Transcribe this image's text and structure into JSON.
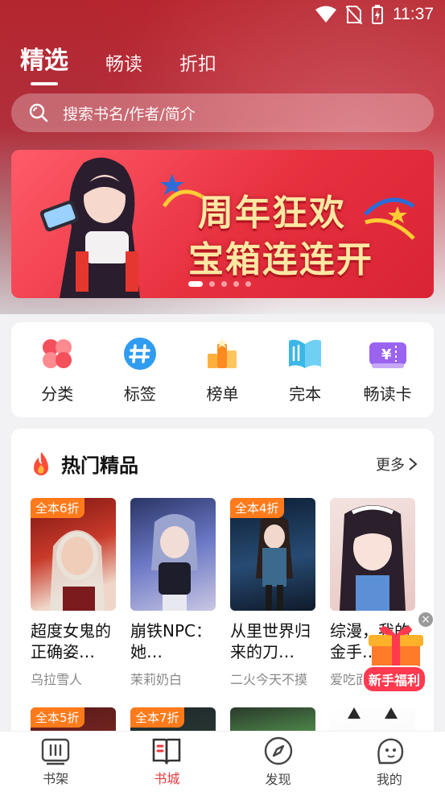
{
  "status_bar": {
    "time": "11:37"
  },
  "top_tabs": [
    {
      "label": "精选",
      "active": true
    },
    {
      "label": "畅读",
      "active": false
    },
    {
      "label": "折扣",
      "active": false
    }
  ],
  "search": {
    "placeholder": "搜索书名/作者/简介"
  },
  "banner": {
    "line1": "周年狂欢",
    "line2": "宝箱连连开",
    "slides": 5,
    "active_slide": 1
  },
  "categories": [
    {
      "label": "分类",
      "icon": "clover-icon",
      "color": "#f4505c"
    },
    {
      "label": "标签",
      "icon": "hashtag-icon",
      "color": "#2f9cf0"
    },
    {
      "label": "榜单",
      "icon": "ranking-icon",
      "color": "#ff9a1f"
    },
    {
      "label": "完本",
      "icon": "open-book-icon",
      "color": "#3bb6e8"
    },
    {
      "label": "畅读卡",
      "icon": "yuan-card-icon",
      "color": "#9a63f0"
    }
  ],
  "hot": {
    "title": "热门精品",
    "more": "更多",
    "books": [
      {
        "tag": "全本6折",
        "title": "超度女鬼的正确姿…",
        "author": "乌拉雪人"
      },
      {
        "tag": "",
        "title": "崩铁NPC：她…",
        "author": "茉莉奶白"
      },
      {
        "tag": "全本4折",
        "title": "从里世界归来的刀…",
        "author": "二火今天不摸"
      },
      {
        "tag": "",
        "title": "综漫，我的金手…",
        "author": "爱吃面"
      }
    ],
    "books_row2": [
      {
        "tag": "全本5折"
      },
      {
        "tag": "全本7折"
      },
      {
        "tag": ""
      },
      {
        "tag": ""
      }
    ]
  },
  "gift": {
    "label": "新手福利",
    "close": "×"
  },
  "bottom_nav": [
    {
      "label": "书架",
      "icon": "bookshelf-icon",
      "active": false
    },
    {
      "label": "书城",
      "icon": "bookstore-icon",
      "active": true
    },
    {
      "label": "发现",
      "icon": "compass-icon",
      "active": false
    },
    {
      "label": "我的",
      "icon": "profile-icon",
      "active": false
    }
  ],
  "colors": {
    "accent": "#e8383d",
    "discount_tag": "#ff7a1a"
  }
}
